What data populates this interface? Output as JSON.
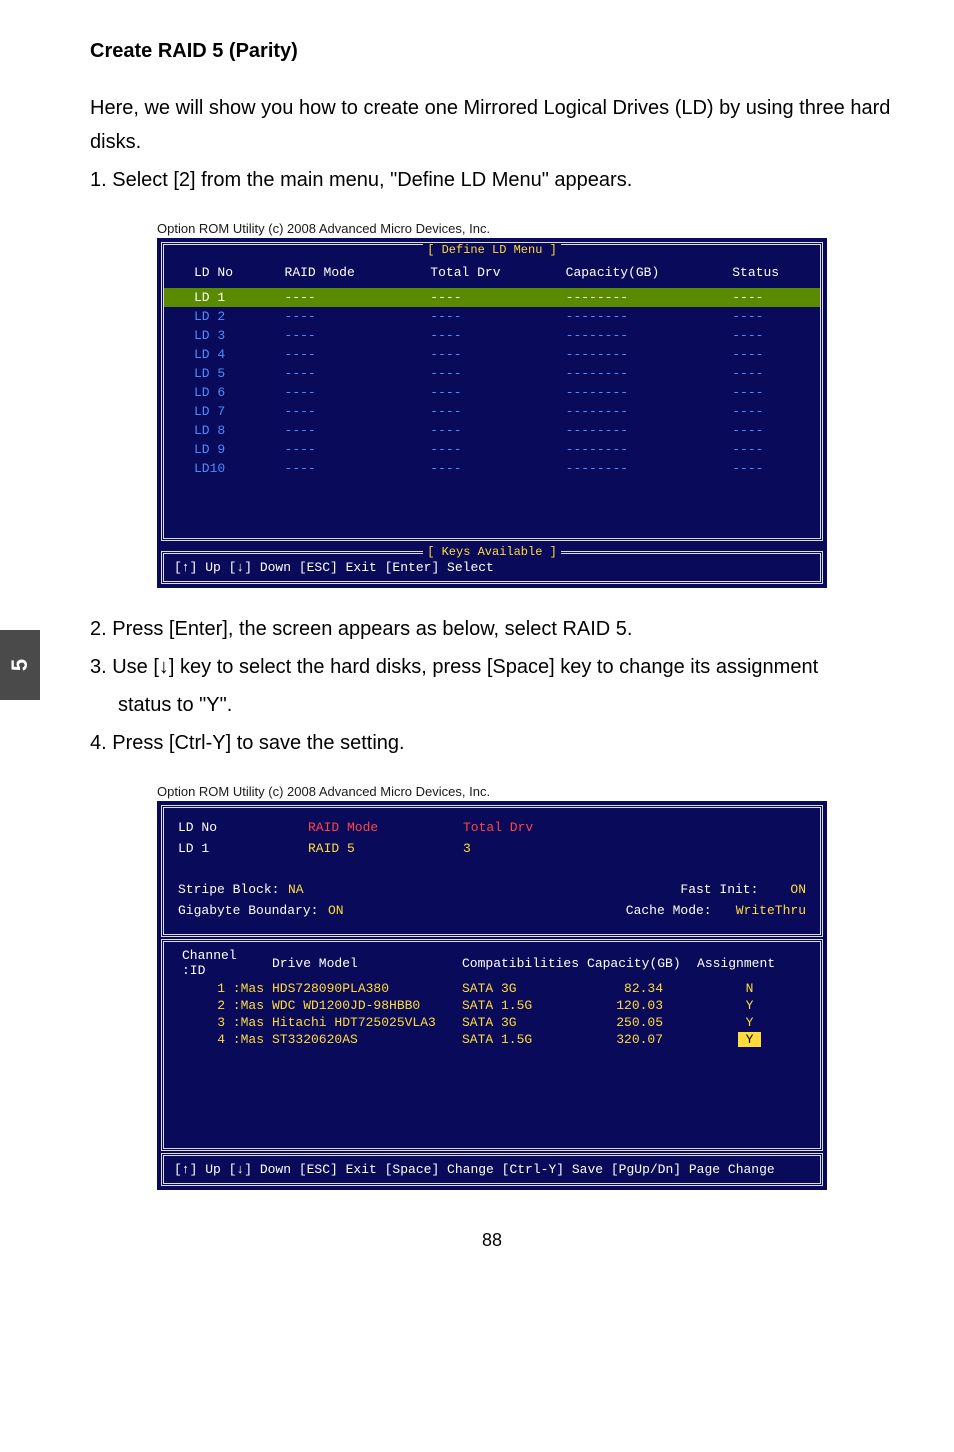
{
  "sideTab": "5",
  "sectionTitle": "Create RAID 5 (Parity)",
  "intro": "Here, we will show you how to create one Mirrored Logical Drives (LD) by using three hard disks.",
  "step1": "1. Select [2] from the main menu, \"Define LD Menu\" appears.",
  "bios1": {
    "caption": "Option ROM Utility (c) 2008 Advanced Micro Devices, Inc.",
    "menuLabel": "[ Define LD Menu ]",
    "headers": {
      "c1": "LD No",
      "c2": "RAID Mode",
      "c3": "Total Drv",
      "c4": "Capacity(GB)",
      "c5": "Status"
    },
    "rows": [
      {
        "c1": "LD  1",
        "c2": "----",
        "c3": "----",
        "c4": "--------",
        "c5": "----",
        "hl": true
      },
      {
        "c1": "LD  2",
        "c2": "----",
        "c3": "----",
        "c4": "--------",
        "c5": "----"
      },
      {
        "c1": "LD  3",
        "c2": "----",
        "c3": "----",
        "c4": "--------",
        "c5": "----"
      },
      {
        "c1": "LD  4",
        "c2": "----",
        "c3": "----",
        "c4": "--------",
        "c5": "----"
      },
      {
        "c1": "LD  5",
        "c2": "----",
        "c3": "----",
        "c4": "--------",
        "c5": "----"
      },
      {
        "c1": "LD  6",
        "c2": "----",
        "c3": "----",
        "c4": "--------",
        "c5": "----"
      },
      {
        "c1": "LD  7",
        "c2": "----",
        "c3": "----",
        "c4": "--------",
        "c5": "----"
      },
      {
        "c1": "LD  8",
        "c2": "----",
        "c3": "----",
        "c4": "--------",
        "c5": "----"
      },
      {
        "c1": "LD  9",
        "c2": "----",
        "c3": "----",
        "c4": "--------",
        "c5": "----"
      },
      {
        "c1": "LD10",
        "c2": "----",
        "c3": "----",
        "c4": "--------",
        "c5": "----"
      }
    ],
    "keysLabel": "[ Keys Available ]",
    "footer": "[↑] Up    [↓] Down    [ESC] Exit    [Enter] Select"
  },
  "step2": "2. Press [Enter], the screen appears as below, select RAID 5.",
  "step3a": "3. Use [↓] key to select the hard disks, press [Space] key to change its assignment",
  "step3b": "status to \"Y\".",
  "step4": "4. Press [Ctrl-Y] to save the setting.",
  "bios2": {
    "caption": "Option ROM Utility (c) 2008 Advanced Micro Devices, Inc.",
    "ldNoLabel": "LD No",
    "raidModeLabel": "RAID Mode",
    "totalDrvLabel": "Total Drv",
    "ldNoVal": "LD  1",
    "raidModeVal": "RAID 5",
    "totalDrvVal": "3",
    "stripeLabel": "Stripe Block:",
    "stripeVal": "NA",
    "gigaLabel": "Gigabyte Boundary:",
    "gigaVal": "ON",
    "fastLabel": "Fast Init:",
    "fastVal": "ON",
    "cacheLabel": "Cache Mode:",
    "cacheVal": "WriteThru",
    "driveHeaders": {
      "ch": "Channel :ID",
      "model": "Drive Model",
      "comp": "Compatibilities",
      "cap": "Capacity(GB)",
      "asg": "Assignment"
    },
    "drives": [
      {
        "ch": "1 :Mas",
        "model": "HDS728090PLA380",
        "comp": "SATA  3G",
        "cap": "82.34",
        "asg": "N",
        "hl": false
      },
      {
        "ch": "2 :Mas",
        "model": "WDC WD1200JD-98HBB0",
        "comp": "SATA  1.5G",
        "cap": "120.03",
        "asg": "Y",
        "hl": false
      },
      {
        "ch": "3 :Mas",
        "model": "Hitachi HDT725025VLA3",
        "comp": "SATA  3G",
        "cap": "250.05",
        "asg": "Y",
        "hl": false
      },
      {
        "ch": "4 :Mas",
        "model": "ST3320620AS",
        "comp": "SATA  1.5G",
        "cap": "320.07",
        "asg": "Y",
        "hl": true
      }
    ],
    "footer": "[↑] Up  [↓] Down  [ESC] Exit  [Space] Change  [Ctrl-Y] Save   [PgUp/Dn] Page Change"
  },
  "pageNum": "88"
}
